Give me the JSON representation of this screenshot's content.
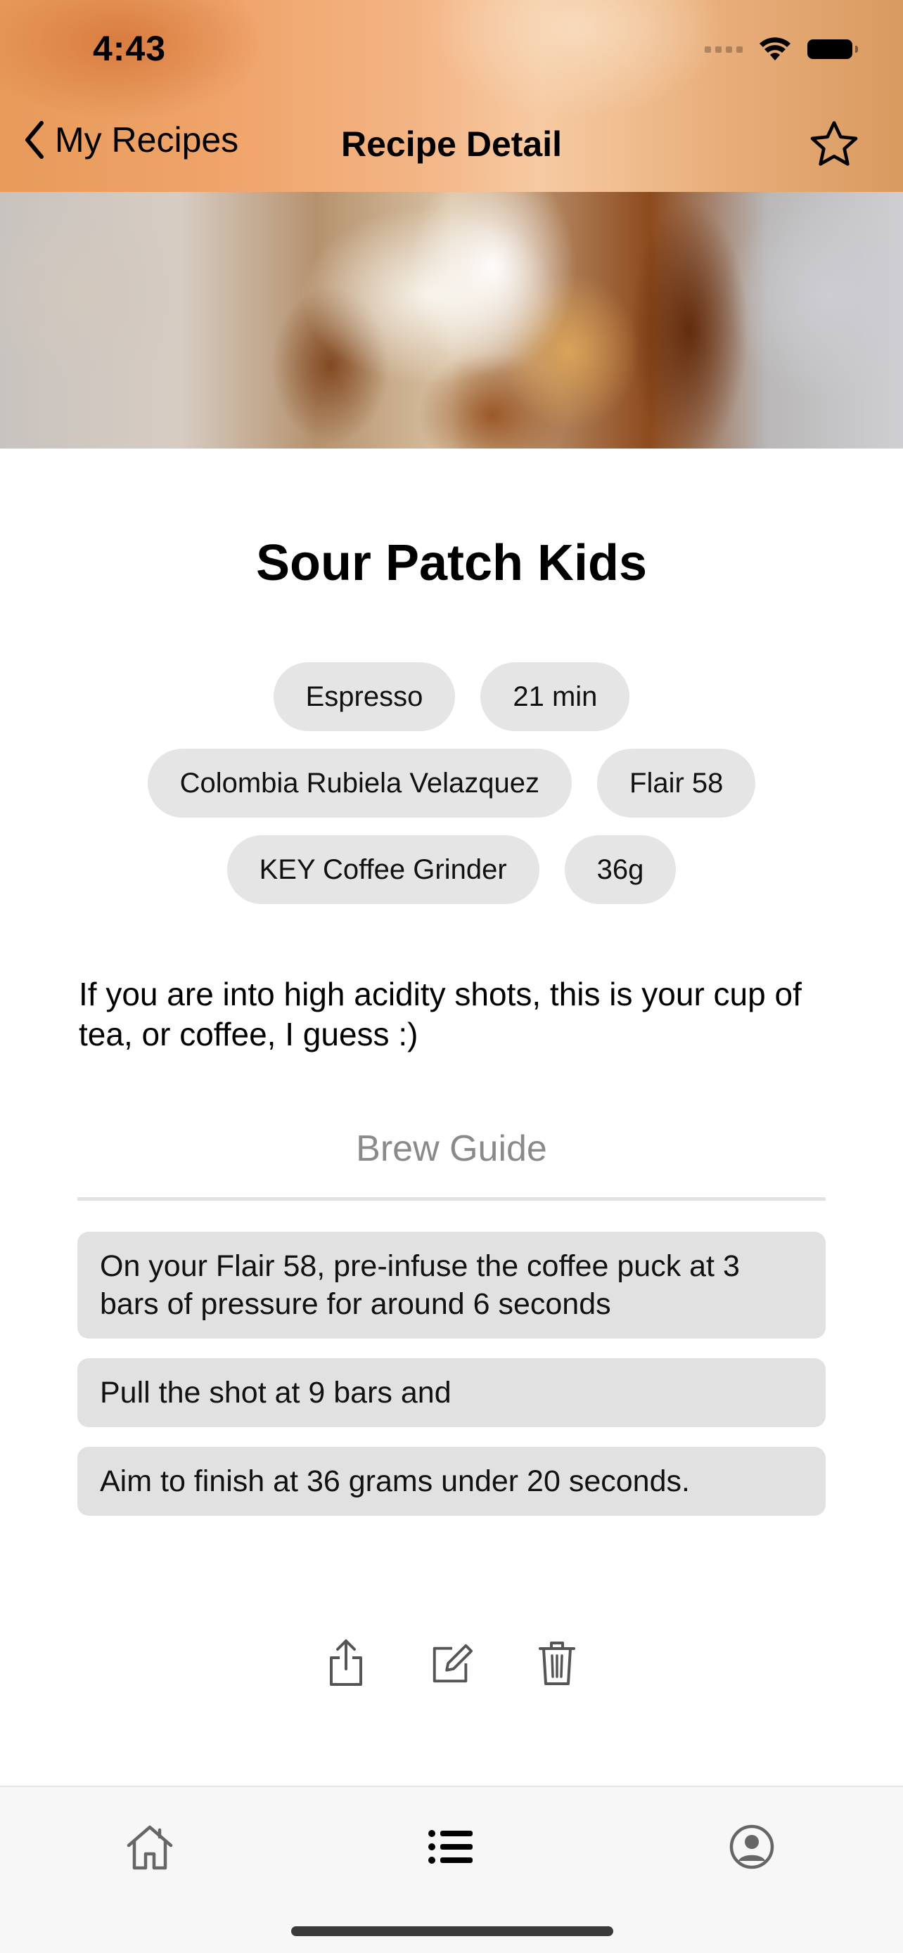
{
  "status_bar": {
    "time": "4:43"
  },
  "nav": {
    "back_label": "My Recipes",
    "title": "Recipe Detail",
    "favorite_icon": "star-outline-icon"
  },
  "recipe": {
    "title": "Sour Patch Kids",
    "tag_rows": [
      [
        "Espresso",
        "21 min"
      ],
      [
        "Colombia Rubiela Velazquez",
        "Flair 58"
      ],
      [
        "KEY Coffee Grinder",
        "36g"
      ]
    ],
    "description": "If you are into high acidity shots, this is your cup of tea, or coffee, I guess :)"
  },
  "brew_guide": {
    "title": "Brew Guide",
    "steps": [
      "On your Flair 58, pre-infuse the coffee puck at 3 bars of pressure for around 6 seconds",
      "Pull the shot at 9 bars and",
      "Aim to finish at 36 grams under 20 seconds."
    ]
  },
  "actions": [
    "share-icon",
    "edit-icon",
    "trash-icon"
  ],
  "tabbar": {
    "tabs": [
      "home-icon",
      "list-icon",
      "profile-icon"
    ],
    "selected": "list-icon"
  }
}
